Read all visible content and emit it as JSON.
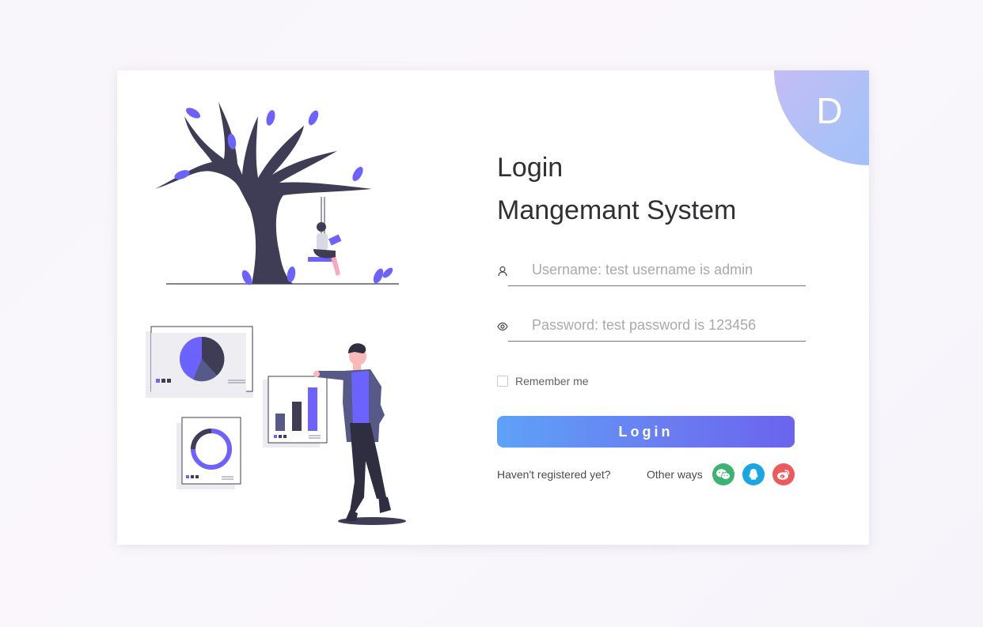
{
  "brand": {
    "letter": "D"
  },
  "login": {
    "title_line1": "Login",
    "title_line2": "Mangemant System",
    "username_placeholder": "Username: test username is admin",
    "password_placeholder": "Password: test password is 123456",
    "remember_label": "Remember me",
    "login_button": "Login",
    "register_link": "Haven't registered yet?",
    "other_ways_label": "Other ways"
  },
  "social": [
    {
      "icon": "wechat-icon",
      "color": "#3cb370"
    },
    {
      "icon": "qq-icon",
      "color": "#1aa6e0"
    },
    {
      "icon": "weibo-icon",
      "color": "#ec5a5d"
    }
  ],
  "colors": {
    "accent_start": "#5ea2f8",
    "accent_end": "#6b64ee",
    "illustration_purple": "#6c63ff",
    "illustration_dark": "#3f3d56"
  }
}
